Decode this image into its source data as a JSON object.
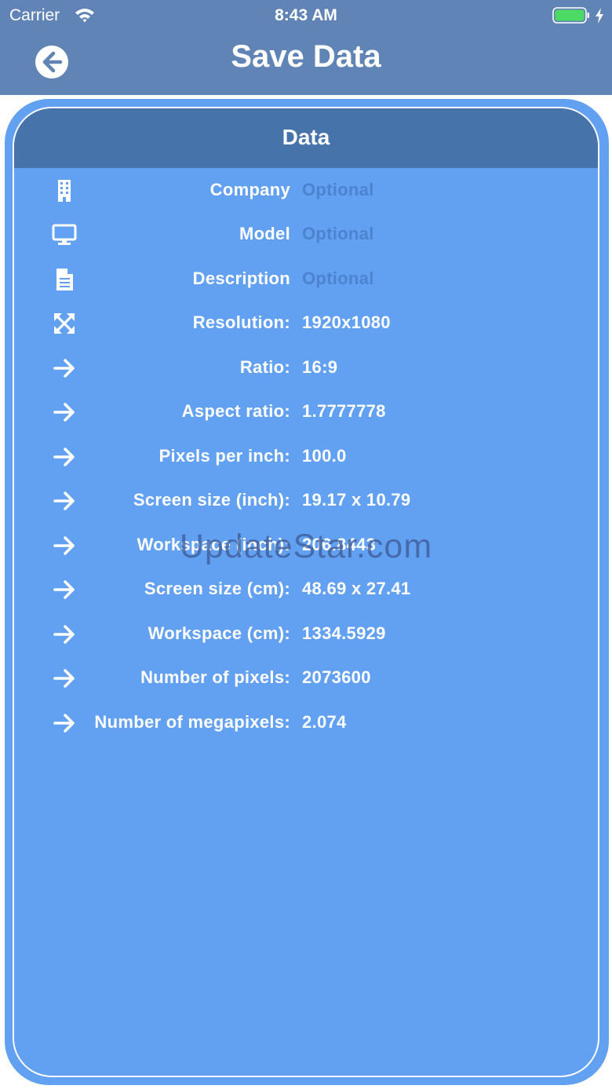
{
  "status_bar": {
    "carrier": "Carrier",
    "time": "8:43 AM",
    "battery_color": "#4cd964"
  },
  "header": {
    "title": "Save Data",
    "back_icon": "arrow-left-circle-icon",
    "color": "#5f84b5"
  },
  "card": {
    "title": "Data",
    "rows": [
      {
        "icon": "building-icon",
        "label": "Company",
        "value": "Optional",
        "placeholder": true
      },
      {
        "icon": "monitor-icon",
        "label": "Model",
        "value": "Optional",
        "placeholder": true
      },
      {
        "icon": "document-icon",
        "label": "Description",
        "value": "Optional",
        "placeholder": true
      },
      {
        "icon": "expand-icon",
        "label": "Resolution:",
        "value": "1920x1080"
      },
      {
        "icon": "arrow-right-icon",
        "label": "Ratio:",
        "value": "16:9"
      },
      {
        "icon": "arrow-right-icon",
        "label": "Aspect ratio:",
        "value": "1.7777778"
      },
      {
        "icon": "arrow-right-icon",
        "label": "Pixels per inch:",
        "value": "100.0"
      },
      {
        "icon": "arrow-right-icon",
        "label": "Screen size (inch):",
        "value": "19.17 x 10.79"
      },
      {
        "icon": "arrow-right-icon",
        "label": "Workspace (inch):",
        "value": "206.8443"
      },
      {
        "icon": "arrow-right-icon",
        "label": "Screen size (cm):",
        "value": "48.69 x 27.41"
      },
      {
        "icon": "arrow-right-icon",
        "label": "Workspace (cm):",
        "value": "1334.5929"
      },
      {
        "icon": "arrow-right-icon",
        "label": "Number of pixels:",
        "value": "2073600"
      },
      {
        "icon": "arrow-right-icon",
        "label": "Number of megapixels:",
        "value": "2.074"
      }
    ]
  },
  "watermark": "UpdateStar.com",
  "colors": {
    "card_bg": "#62a0f2",
    "card_header": "#4573aa",
    "placeholder_text": "#4d82cf"
  }
}
